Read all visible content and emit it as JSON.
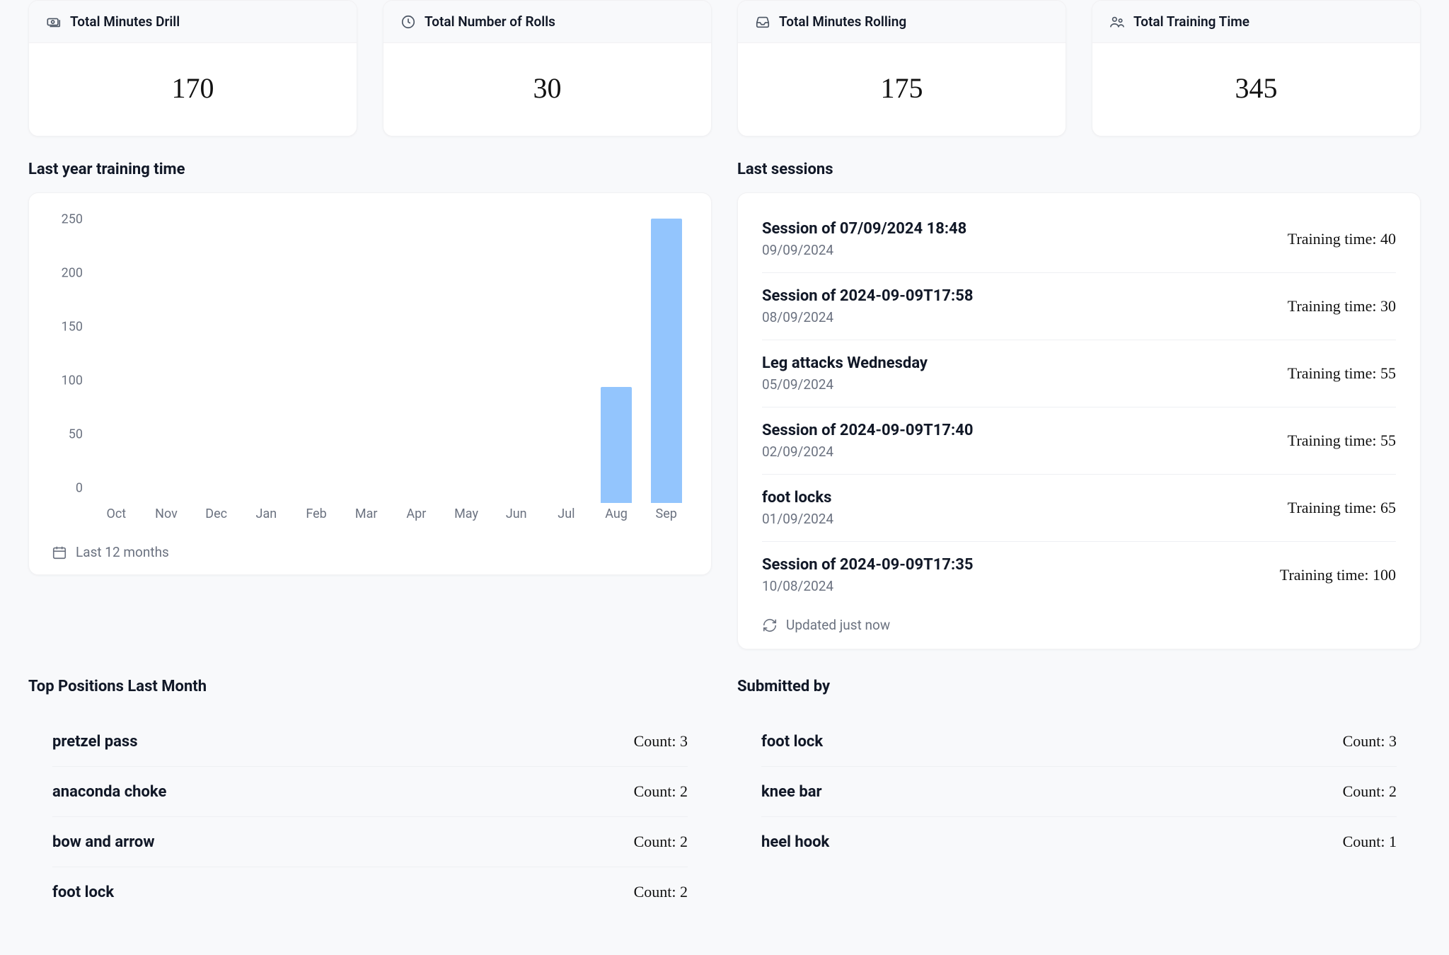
{
  "stats": [
    {
      "label": "Total Minutes Drill",
      "value": "170",
      "icon": "banknotes"
    },
    {
      "label": "Total Number of Rolls",
      "value": "30",
      "icon": "clock"
    },
    {
      "label": "Total Minutes Rolling",
      "value": "175",
      "icon": "inbox"
    },
    {
      "label": "Total Training Time",
      "value": "345",
      "icon": "people"
    }
  ],
  "chart_title": "Last year training time",
  "chart_footer": "Last 12 months",
  "chart_data": {
    "type": "bar",
    "categories": [
      "Oct",
      "Nov",
      "Dec",
      "Jan",
      "Feb",
      "Mar",
      "Apr",
      "May",
      "Jun",
      "Jul",
      "Aug",
      "Sep"
    ],
    "values": [
      0,
      0,
      0,
      0,
      0,
      0,
      0,
      0,
      0,
      0,
      100,
      245
    ],
    "title": "Last year training time",
    "xlabel": "",
    "ylabel": "",
    "ylim": [
      0,
      250
    ],
    "y_ticks": [
      0,
      50,
      100,
      150,
      200,
      250
    ]
  },
  "sessions_title": "Last sessions",
  "sessions": [
    {
      "title": "Session of 07/09/2024 18:48",
      "date": "09/09/2024",
      "time_label": "Training time: 40"
    },
    {
      "title": "Session of 2024-09-09T17:58",
      "date": "08/09/2024",
      "time_label": "Training time: 30"
    },
    {
      "title": "Leg attacks Wednesday",
      "date": "05/09/2024",
      "time_label": "Training time: 55"
    },
    {
      "title": "Session of 2024-09-09T17:40",
      "date": "02/09/2024",
      "time_label": "Training time: 55"
    },
    {
      "title": "foot locks",
      "date": "01/09/2024",
      "time_label": "Training time: 65"
    },
    {
      "title": "Session of 2024-09-09T17:35",
      "date": "10/08/2024",
      "time_label": "Training time: 100"
    }
  ],
  "sessions_footer": "Updated just now",
  "positions_title": "Top Positions Last Month",
  "positions": [
    {
      "name": "pretzel pass",
      "count_label": "Count: 3"
    },
    {
      "name": "anaconda choke",
      "count_label": "Count: 2"
    },
    {
      "name": "bow and arrow",
      "count_label": "Count: 2"
    },
    {
      "name": "foot lock",
      "count_label": "Count: 2"
    }
  ],
  "submitted_title": "Submitted by",
  "submitted": [
    {
      "name": "foot lock",
      "count_label": "Count: 3"
    },
    {
      "name": "knee bar",
      "count_label": "Count: 2"
    },
    {
      "name": "heel hook",
      "count_label": "Count: 1"
    }
  ]
}
